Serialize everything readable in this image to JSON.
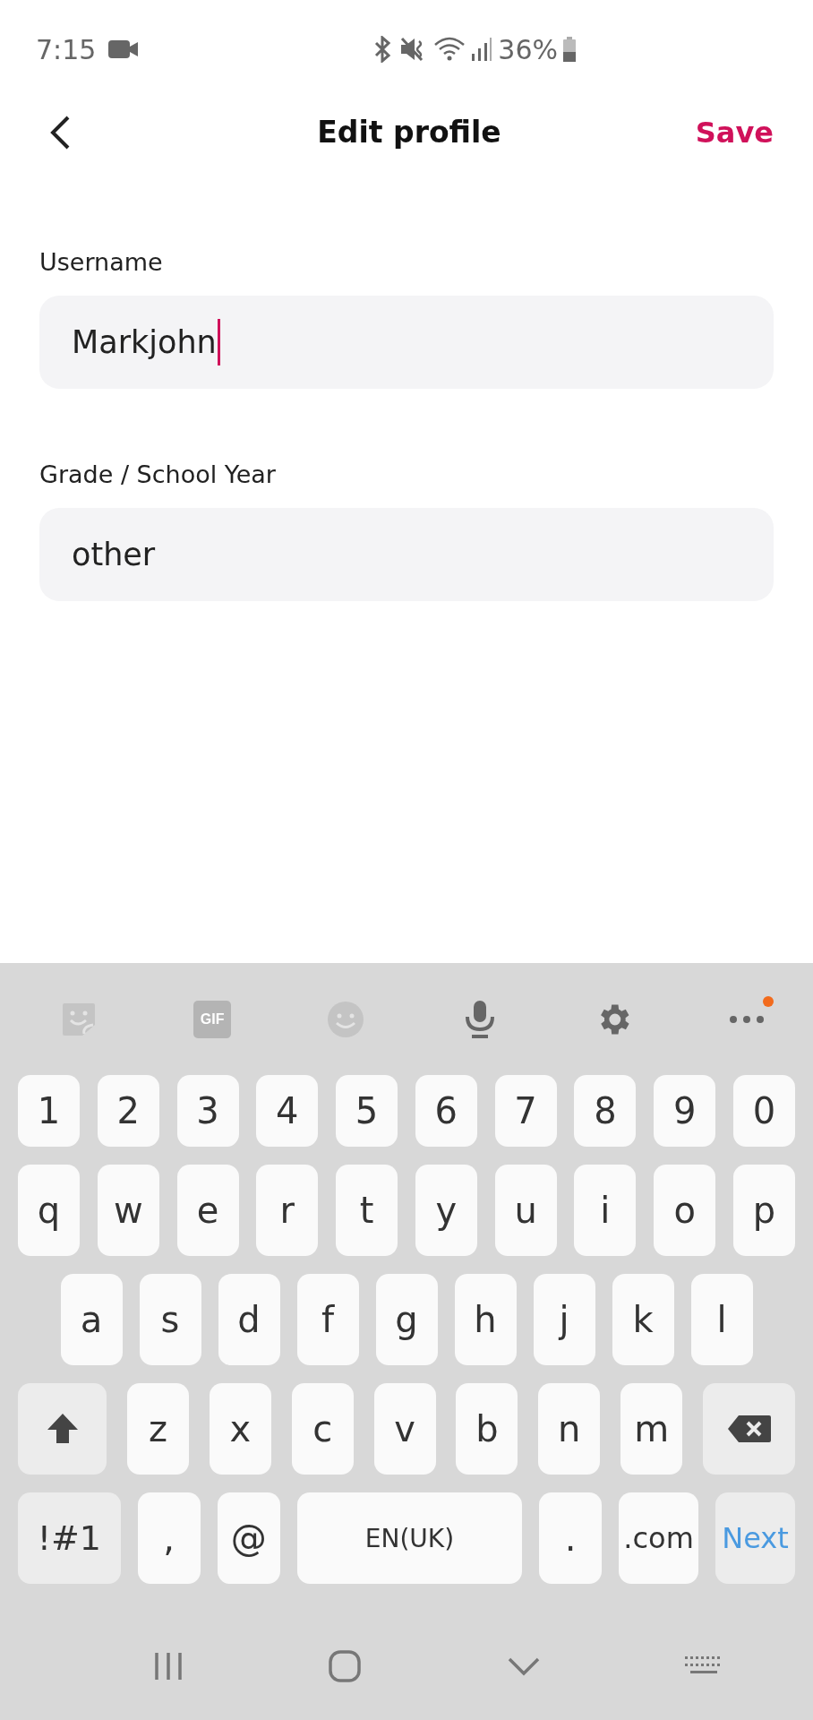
{
  "status_bar": {
    "time": "7:15",
    "battery": "36%"
  },
  "header": {
    "title": "Edit profile",
    "save": "Save"
  },
  "fields": [
    {
      "label": "Username",
      "value": "Markjohn",
      "focused": true
    },
    {
      "label": "Grade / School Year",
      "value": "other",
      "focused": false
    }
  ],
  "keyboard": {
    "toolbar": [
      {
        "kind": "sticker",
        "disabled": true
      },
      {
        "kind": "gif",
        "label": "GIF",
        "disabled": true
      },
      {
        "kind": "emoji",
        "disabled": true
      },
      {
        "kind": "mic",
        "disabled": false
      },
      {
        "kind": "settings",
        "disabled": false
      },
      {
        "kind": "more",
        "disabled": false,
        "badge": true
      }
    ],
    "rows": [
      {
        "keys": [
          {
            "kind": "num",
            "label": "1"
          },
          {
            "kind": "num",
            "label": "2"
          },
          {
            "kind": "num",
            "label": "3"
          },
          {
            "kind": "num",
            "label": "4"
          },
          {
            "kind": "num",
            "label": "5"
          },
          {
            "kind": "num",
            "label": "6"
          },
          {
            "kind": "num",
            "label": "7"
          },
          {
            "kind": "num",
            "label": "8"
          },
          {
            "kind": "num",
            "label": "9"
          },
          {
            "kind": "num",
            "label": "0"
          }
        ]
      },
      {
        "keys": [
          {
            "kind": "char",
            "label": "q"
          },
          {
            "kind": "char",
            "label": "w"
          },
          {
            "kind": "char",
            "label": "e"
          },
          {
            "kind": "char",
            "label": "r"
          },
          {
            "kind": "char",
            "label": "t"
          },
          {
            "kind": "char",
            "label": "y"
          },
          {
            "kind": "char",
            "label": "u"
          },
          {
            "kind": "char",
            "label": "i"
          },
          {
            "kind": "char",
            "label": "o"
          },
          {
            "kind": "char",
            "label": "p"
          }
        ]
      },
      {
        "keys": [
          {
            "kind": "char",
            "label": "a"
          },
          {
            "kind": "char",
            "label": "s"
          },
          {
            "kind": "char",
            "label": "d"
          },
          {
            "kind": "char",
            "label": "f"
          },
          {
            "kind": "char",
            "label": "g"
          },
          {
            "kind": "char",
            "label": "h"
          },
          {
            "kind": "char",
            "label": "j"
          },
          {
            "kind": "char",
            "label": "k"
          },
          {
            "kind": "char",
            "label": "l"
          }
        ]
      },
      {
        "keys": [
          {
            "kind": "shift"
          },
          {
            "kind": "char",
            "label": "z"
          },
          {
            "kind": "char",
            "label": "x"
          },
          {
            "kind": "char",
            "label": "c"
          },
          {
            "kind": "char",
            "label": "v"
          },
          {
            "kind": "char",
            "label": "b"
          },
          {
            "kind": "char",
            "label": "n"
          },
          {
            "kind": "char",
            "label": "m"
          },
          {
            "kind": "backspace"
          }
        ]
      },
      {
        "keys": [
          {
            "kind": "symbols",
            "label": "!#1"
          },
          {
            "kind": "punct",
            "label": ","
          },
          {
            "kind": "punct",
            "label": "@"
          },
          {
            "kind": "space",
            "label": "EN(UK)"
          },
          {
            "kind": "punct",
            "label": "."
          },
          {
            "kind": "dotcom",
            "label": ".com"
          },
          {
            "kind": "action",
            "label": "Next"
          }
        ]
      }
    ]
  }
}
